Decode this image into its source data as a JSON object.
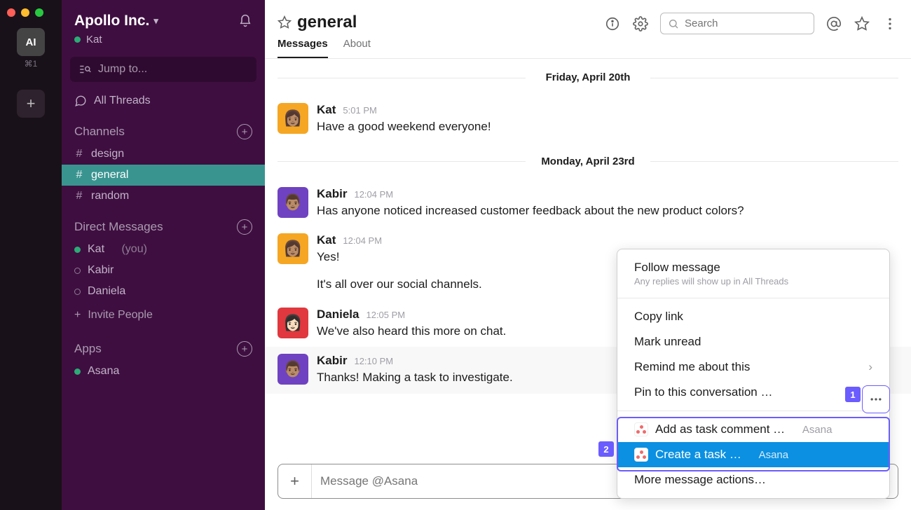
{
  "rail": {
    "workspace_abbrev": "AI",
    "shortcut": "⌘1"
  },
  "sidebar": {
    "workspace": "Apollo Inc.",
    "user": "Kat",
    "jump_label": "Jump to...",
    "all_threads": "All Threads",
    "channels_label": "Channels",
    "channels": [
      {
        "name": "design",
        "active": false
      },
      {
        "name": "general",
        "active": true
      },
      {
        "name": "random",
        "active": false
      }
    ],
    "dm_label": "Direct Messages",
    "dms": [
      {
        "name": "Kat",
        "you_suffix": "(you)",
        "online": true
      },
      {
        "name": "Kabir",
        "online": false
      },
      {
        "name": "Daniela",
        "online": false
      }
    ],
    "invite_label": "Invite People",
    "apps_label": "Apps",
    "apps": [
      {
        "name": "Asana",
        "online": true
      }
    ]
  },
  "header": {
    "channel": "general",
    "tabs": {
      "messages": "Messages",
      "about": "About"
    },
    "search_placeholder": "Search"
  },
  "dividers": {
    "d0": "Friday, April 20th",
    "d1": "Monday, April 23rd"
  },
  "messages": [
    {
      "author": "Kat",
      "time": "5:01 PM",
      "text": "Have a good weekend everyone!",
      "avatar": "kat"
    },
    {
      "author": "Kabir",
      "time": "12:04 PM",
      "text": "Has anyone noticed increased customer feedback about the new product colors?",
      "avatar": "kabir"
    },
    {
      "author": "Kat",
      "time": "12:04 PM",
      "text": "Yes!",
      "text2": "It's all over our social channels.",
      "avatar": "kat"
    },
    {
      "author": "Daniela",
      "time": "12:05 PM",
      "text": "We've also heard this more on chat.",
      "avatar": "daniela"
    },
    {
      "author": "Kabir",
      "time": "12:10 PM",
      "text": "Thanks! Making a task to investigate.",
      "avatar": "kabir"
    }
  ],
  "composer": {
    "placeholder": "Message @Asana"
  },
  "menu": {
    "follow_title": "Follow message",
    "follow_sub": "Any replies will show up in All Threads",
    "copy_link": "Copy link",
    "mark_unread": "Mark unread",
    "remind": "Remind me about this",
    "pin": "Pin to this conversation …",
    "add_task_comment": "Add as task comment …",
    "create_task": "Create a task …",
    "more_actions": "More message actions…",
    "brand": "Asana"
  },
  "callouts": {
    "n1": "1",
    "n2": "2"
  }
}
